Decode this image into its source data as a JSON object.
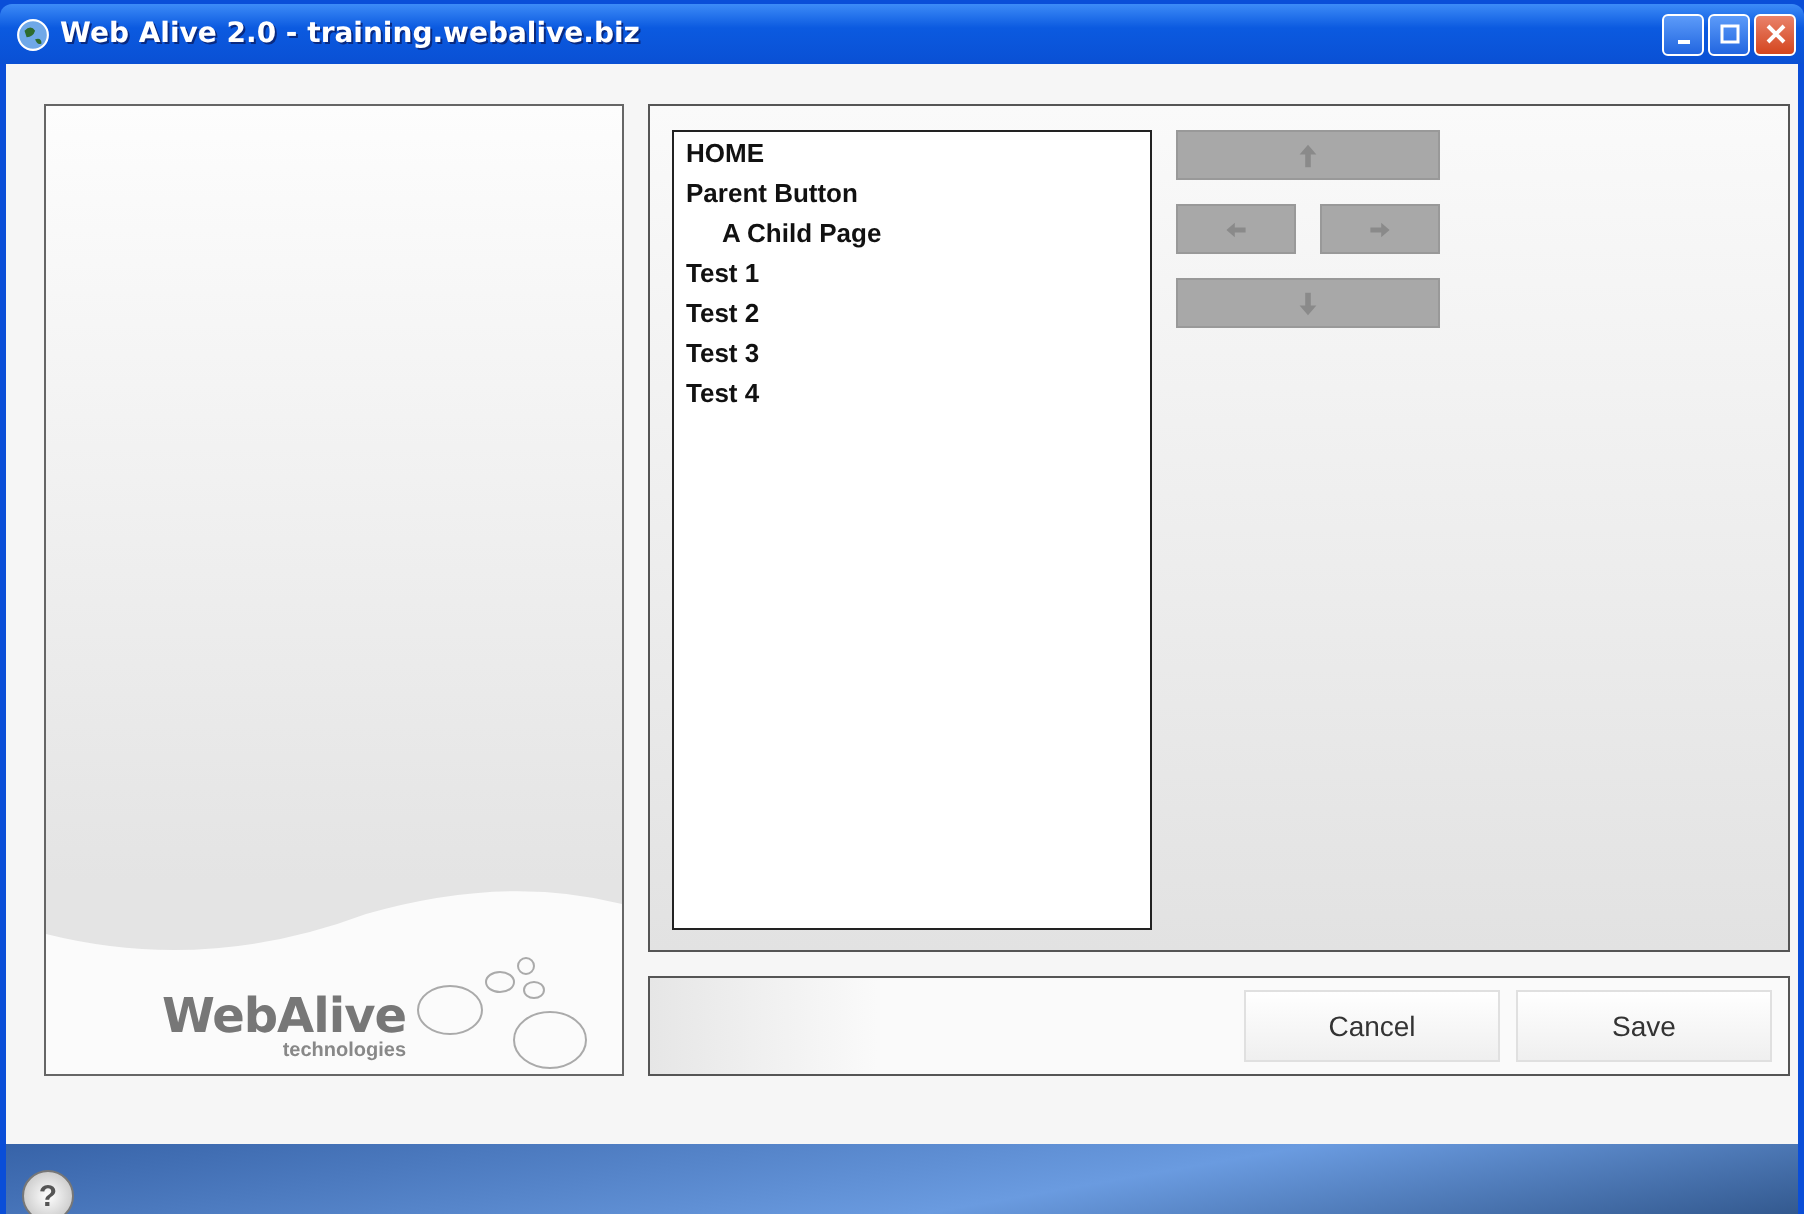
{
  "window": {
    "title": "Web Alive 2.0 - training.webalive.biz"
  },
  "logo": {
    "name": "WebAlive",
    "tagline": "technologies"
  },
  "pages": [
    {
      "label": "HOME"
    },
    {
      "label": "Parent Button",
      "children": [
        {
          "label": "A Child Page"
        }
      ]
    },
    {
      "label": "Test 1"
    },
    {
      "label": "Test 2"
    },
    {
      "label": "Test 3"
    },
    {
      "label": "Test 4"
    }
  ],
  "move_buttons": [
    {
      "kind": "up"
    },
    {
      "kind": "left"
    },
    {
      "kind": "right"
    },
    {
      "kind": "down"
    }
  ],
  "buttons": [
    "Cancel",
    "Save"
  ],
  "help": {
    "label": "?"
  }
}
